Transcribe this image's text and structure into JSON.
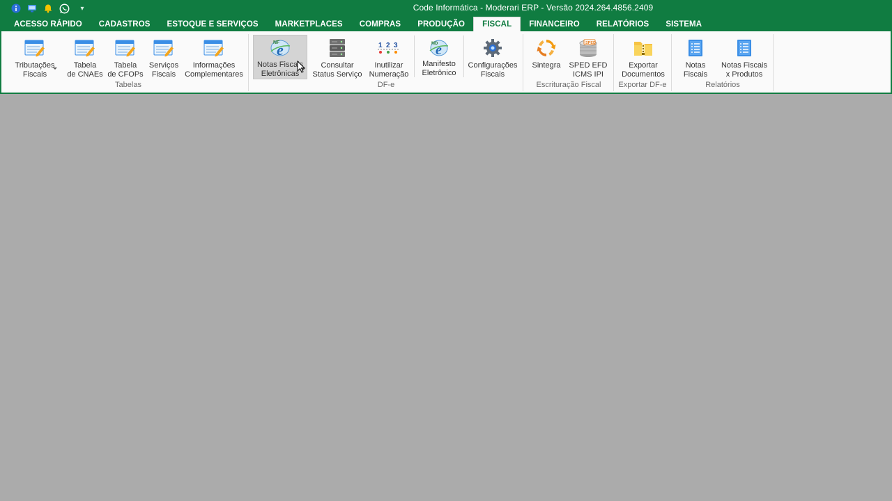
{
  "window": {
    "title": "Code Informática - Moderari ERP - Versão 2024.264.4856.2409"
  },
  "quick_access": [
    {
      "name": "info-icon"
    },
    {
      "name": "monitor-icon"
    },
    {
      "name": "bell-icon"
    },
    {
      "name": "whatsapp-icon"
    }
  ],
  "quick_access_more": "▾",
  "tabs": [
    {
      "label": "ACESSO RÁPIDO",
      "active": false
    },
    {
      "label": "CADASTROS",
      "active": false
    },
    {
      "label": "ESTOQUE E SERVIÇOS",
      "active": false
    },
    {
      "label": "MARKETPLACES",
      "active": false
    },
    {
      "label": "COMPRAS",
      "active": false
    },
    {
      "label": "PRODUÇÃO",
      "active": false
    },
    {
      "label": "FISCAL",
      "active": true
    },
    {
      "label": "FINANCEIRO",
      "active": false
    },
    {
      "label": "RELATÓRIOS",
      "active": false
    },
    {
      "label": "SISTEMA",
      "active": false
    }
  ],
  "ribbon": {
    "groups": {
      "tabelas": {
        "label": "Tabelas",
        "buttons": {
          "tributacoes": {
            "line1": "Tributações",
            "line2": "Fiscais",
            "icon": "table-edit-icon"
          },
          "cnaes": {
            "line1": "Tabela",
            "line2": "de CNAEs",
            "icon": "table-edit-icon"
          },
          "cfops": {
            "line1": "Tabela",
            "line2": "de CFOPs",
            "icon": "table-edit-icon"
          },
          "servicos": {
            "line1": "Serviços",
            "line2": "Fiscais",
            "icon": "table-edit-icon"
          },
          "informacoes": {
            "line1": "Informações",
            "line2": "Complementares",
            "icon": "table-edit-icon"
          }
        }
      },
      "dfe": {
        "label": "DF-e",
        "buttons": {
          "notas": {
            "line1": "Notas Fiscais",
            "line2": "Eletrônicas",
            "icon": "nfe-icon"
          },
          "status": {
            "line1": "Consultar",
            "line2": "Status Serviço",
            "icon": "server-icon"
          },
          "inutilizar": {
            "line1": "Inutilizar",
            "line2": "Numeração",
            "icon": "numbering-icon"
          },
          "manifesto": {
            "line1": "Manifesto",
            "line2": "Eletrônico",
            "icon": "manifest-icon"
          },
          "config": {
            "line1": "Configurações",
            "line2": "Fiscais",
            "icon": "gear-icon"
          }
        }
      },
      "escrituracao": {
        "label": "Escrituração Fiscal",
        "buttons": {
          "sintegra": {
            "line1": "Sintegra",
            "line2": "",
            "icon": "sync-icon"
          },
          "sped": {
            "line1": "SPED EFD",
            "line2": "ICMS IPI",
            "icon": "sped-icon"
          }
        }
      },
      "exportar": {
        "label": "Exportar DF-e",
        "buttons": {
          "exportar": {
            "line1": "Exportar",
            "line2": "Documentos",
            "icon": "zip-folder-icon"
          }
        }
      },
      "relatorios": {
        "label": "Relatórios",
        "buttons": {
          "notas_fiscais": {
            "line1": "Notas",
            "line2": "Fiscais",
            "icon": "report-icon"
          },
          "notas_produtos": {
            "line1": "Notas Fiscais",
            "line2": "x Produtos",
            "icon": "report-icon"
          }
        }
      }
    }
  },
  "colors": {
    "brand_green": "#107c41",
    "workspace_gray": "#ababab"
  }
}
